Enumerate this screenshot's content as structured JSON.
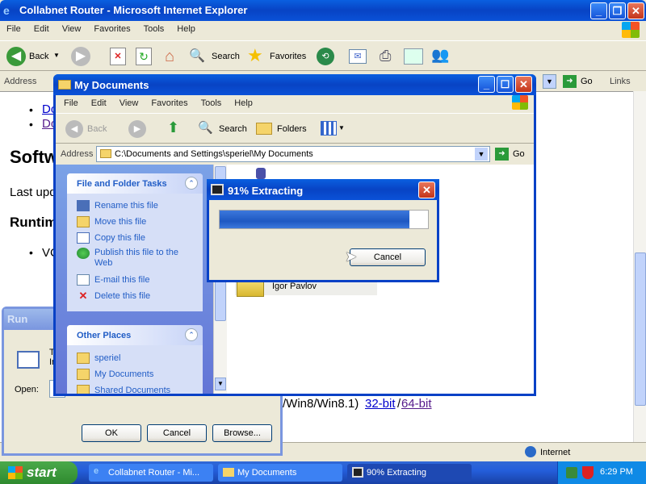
{
  "ie": {
    "title": "Collabnet Router - Microsoft Internet Explorer",
    "menu": [
      "File",
      "Edit",
      "View",
      "Favorites",
      "Tools",
      "Help"
    ],
    "toolbar": {
      "back": "Back",
      "search": "Search",
      "favorites": "Favorites"
    },
    "address_label": "Address",
    "go": "Go",
    "links": "Links",
    "status_zone": "Internet",
    "page": {
      "bullet1": "Do",
      "bullet2": "Do",
      "heading1": "Softw",
      "lastupdate": "Last upd",
      "heading2": "Runtim",
      "bullet3": "VC",
      "bottom_text": "/Win8/Win8.1)",
      "link32": "32-bit",
      "slash": "/",
      "link64": "64-bit"
    }
  },
  "explorer": {
    "title": "My Documents",
    "menu": [
      "File",
      "Edit",
      "View",
      "Favorites",
      "Tools",
      "Help"
    ],
    "toolbar": {
      "back": "Back",
      "search": "Search",
      "folders": "Folders"
    },
    "address_label": "Address",
    "address_value": "C:\\Documents and Settings\\speriel\\My Documents",
    "go": "Go",
    "tasks_title": "File and Folder Tasks",
    "tasks": [
      "Rename this file",
      "Move this file",
      "Copy this file",
      "Publish this file to the Web",
      "E-mail this file",
      "Delete this file"
    ],
    "places_title": "Other Places",
    "places": [
      "speriel",
      "My Documents",
      "Shared Documents"
    ],
    "folder_label": "Igor Pavlov"
  },
  "extract": {
    "title": "91% Extracting",
    "progress": 0.91,
    "cancel": "Cancel"
  },
  "run": {
    "title": "Run",
    "desc1": "T",
    "desc2": "In",
    "open_label": "Open:",
    "ok": "OK",
    "cancel": "Cancel",
    "browse": "Browse..."
  },
  "taskbar": {
    "start": "start",
    "items": [
      "Collabnet Router - Mi...",
      "My Documents",
      "90% Extracting"
    ],
    "clock": "6:29 PM"
  }
}
